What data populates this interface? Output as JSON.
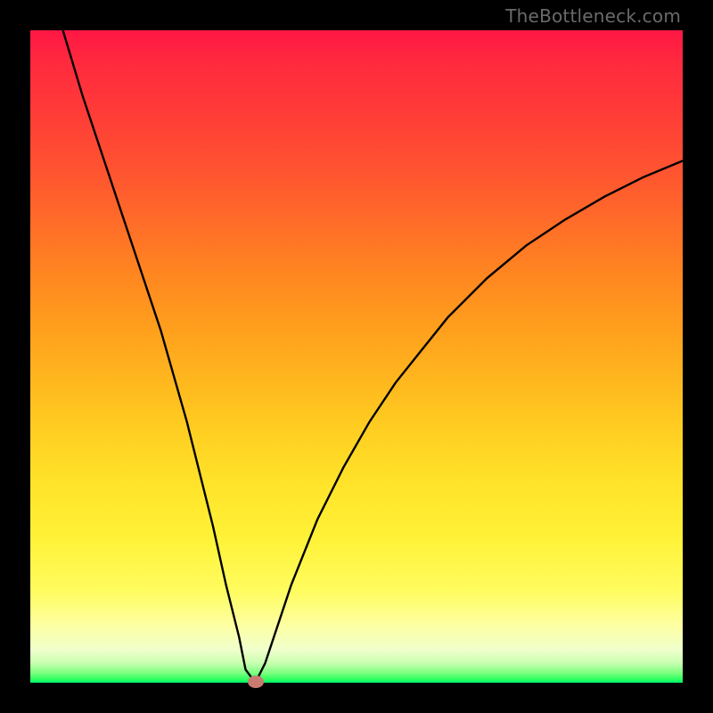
{
  "brand_text": "TheBottleneck.com",
  "chart_data": {
    "type": "line",
    "title": "",
    "xlabel": "",
    "ylabel": "",
    "xlim": [
      0,
      100
    ],
    "ylim": [
      0,
      100
    ],
    "grid": false,
    "background": {
      "gradient": "vertical",
      "stops": [
        {
          "pos": 0,
          "color": "#ff1744"
        },
        {
          "pos": 50,
          "color": "#ffb81e"
        },
        {
          "pos": 80,
          "color": "#fff238"
        },
        {
          "pos": 100,
          "color": "#00ff6a"
        }
      ]
    },
    "series": [
      {
        "name": "bottleneck-curve",
        "x": [
          5,
          8,
          12,
          16,
          20,
          24,
          28,
          30,
          32,
          33,
          34.5,
          36,
          38,
          40,
          44,
          48,
          52,
          56,
          60,
          64,
          70,
          76,
          82,
          88,
          94,
          100
        ],
        "y": [
          100,
          90,
          78,
          66,
          54,
          40,
          24,
          15,
          7,
          2,
          0,
          3,
          9,
          15,
          25,
          33,
          40,
          46,
          51,
          56,
          62,
          67,
          71,
          74.5,
          77.5,
          80
        ]
      }
    ],
    "marker": {
      "x": 34.5,
      "y": 0,
      "color": "#c97b71"
    }
  }
}
